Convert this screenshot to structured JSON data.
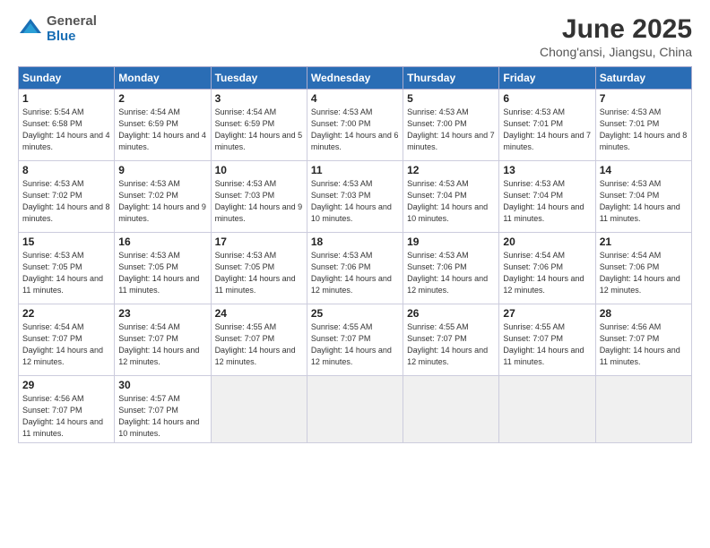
{
  "header": {
    "logo_general": "General",
    "logo_blue": "Blue",
    "month_title": "June 2025",
    "location": "Chong'ansi, Jiangsu, China"
  },
  "days_of_week": [
    "Sunday",
    "Monday",
    "Tuesday",
    "Wednesday",
    "Thursday",
    "Friday",
    "Saturday"
  ],
  "weeks": [
    [
      {
        "day": 1,
        "sunrise": "5:54 AM",
        "sunset": "6:58 PM",
        "daylight": "14 hours and 4 minutes."
      },
      {
        "day": 2,
        "sunrise": "4:54 AM",
        "sunset": "6:59 PM",
        "daylight": "14 hours and 4 minutes."
      },
      {
        "day": 3,
        "sunrise": "4:54 AM",
        "sunset": "6:59 PM",
        "daylight": "14 hours and 5 minutes."
      },
      {
        "day": 4,
        "sunrise": "4:53 AM",
        "sunset": "7:00 PM",
        "daylight": "14 hours and 6 minutes."
      },
      {
        "day": 5,
        "sunrise": "4:53 AM",
        "sunset": "7:00 PM",
        "daylight": "14 hours and 7 minutes."
      },
      {
        "day": 6,
        "sunrise": "4:53 AM",
        "sunset": "7:01 PM",
        "daylight": "14 hours and 7 minutes."
      },
      {
        "day": 7,
        "sunrise": "4:53 AM",
        "sunset": "7:01 PM",
        "daylight": "14 hours and 8 minutes."
      }
    ],
    [
      {
        "day": 8,
        "sunrise": "4:53 AM",
        "sunset": "7:02 PM",
        "daylight": "14 hours and 8 minutes."
      },
      {
        "day": 9,
        "sunrise": "4:53 AM",
        "sunset": "7:02 PM",
        "daylight": "14 hours and 9 minutes."
      },
      {
        "day": 10,
        "sunrise": "4:53 AM",
        "sunset": "7:03 PM",
        "daylight": "14 hours and 9 minutes."
      },
      {
        "day": 11,
        "sunrise": "4:53 AM",
        "sunset": "7:03 PM",
        "daylight": "14 hours and 10 minutes."
      },
      {
        "day": 12,
        "sunrise": "4:53 AM",
        "sunset": "7:04 PM",
        "daylight": "14 hours and 10 minutes."
      },
      {
        "day": 13,
        "sunrise": "4:53 AM",
        "sunset": "7:04 PM",
        "daylight": "14 hours and 11 minutes."
      },
      {
        "day": 14,
        "sunrise": "4:53 AM",
        "sunset": "7:04 PM",
        "daylight": "14 hours and 11 minutes."
      }
    ],
    [
      {
        "day": 15,
        "sunrise": "4:53 AM",
        "sunset": "7:05 PM",
        "daylight": "14 hours and 11 minutes."
      },
      {
        "day": 16,
        "sunrise": "4:53 AM",
        "sunset": "7:05 PM",
        "daylight": "14 hours and 11 minutes."
      },
      {
        "day": 17,
        "sunrise": "4:53 AM",
        "sunset": "7:05 PM",
        "daylight": "14 hours and 11 minutes."
      },
      {
        "day": 18,
        "sunrise": "4:53 AM",
        "sunset": "7:06 PM",
        "daylight": "14 hours and 12 minutes."
      },
      {
        "day": 19,
        "sunrise": "4:53 AM",
        "sunset": "7:06 PM",
        "daylight": "14 hours and 12 minutes."
      },
      {
        "day": 20,
        "sunrise": "4:54 AM",
        "sunset": "7:06 PM",
        "daylight": "14 hours and 12 minutes."
      },
      {
        "day": 21,
        "sunrise": "4:54 AM",
        "sunset": "7:06 PM",
        "daylight": "14 hours and 12 minutes."
      }
    ],
    [
      {
        "day": 22,
        "sunrise": "4:54 AM",
        "sunset": "7:07 PM",
        "daylight": "14 hours and 12 minutes."
      },
      {
        "day": 23,
        "sunrise": "4:54 AM",
        "sunset": "7:07 PM",
        "daylight": "14 hours and 12 minutes."
      },
      {
        "day": 24,
        "sunrise": "4:55 AM",
        "sunset": "7:07 PM",
        "daylight": "14 hours and 12 minutes."
      },
      {
        "day": 25,
        "sunrise": "4:55 AM",
        "sunset": "7:07 PM",
        "daylight": "14 hours and 12 minutes."
      },
      {
        "day": 26,
        "sunrise": "4:55 AM",
        "sunset": "7:07 PM",
        "daylight": "14 hours and 12 minutes."
      },
      {
        "day": 27,
        "sunrise": "4:55 AM",
        "sunset": "7:07 PM",
        "daylight": "14 hours and 11 minutes."
      },
      {
        "day": 28,
        "sunrise": "4:56 AM",
        "sunset": "7:07 PM",
        "daylight": "14 hours and 11 minutes."
      }
    ],
    [
      {
        "day": 29,
        "sunrise": "4:56 AM",
        "sunset": "7:07 PM",
        "daylight": "14 hours and 11 minutes."
      },
      {
        "day": 30,
        "sunrise": "4:57 AM",
        "sunset": "7:07 PM",
        "daylight": "14 hours and 10 minutes."
      },
      null,
      null,
      null,
      null,
      null
    ]
  ]
}
